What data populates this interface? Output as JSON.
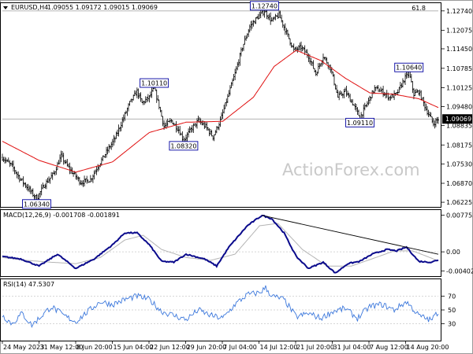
{
  "header": {
    "symbol": "EURUSD,H4",
    "ohlc": "1.09055 1.09172 1.09015 1.09069",
    "fib_label": "61.8"
  },
  "watermark": "ActionForex.com",
  "colors": {
    "price": "#000000",
    "ma": "#e01010",
    "macd": "#0a0a8c",
    "signal": "#b4b4b4",
    "rsi": "#3c78dc",
    "trendline": "#000000",
    "level_box": "#0000a0"
  },
  "chart_data": [
    {
      "type": "candlestick",
      "panel": "price",
      "title": "EURUSD,H4",
      "ylim": [
        1.0612,
        1.1295
      ],
      "y_ticks": [
        "1.12740",
        "1.12075",
        "1.11450",
        "1.10785",
        "1.10125",
        "1.09480",
        "1.08835",
        "1.08175",
        "1.07530",
        "1.06870",
        "1.06225"
      ],
      "x_labels": [
        "24 May 2023",
        "31 May 12:00",
        "8 Jun 20:00",
        "15 Jun 04:00",
        "22 Jun 12:00",
        "29 Jun 20:00",
        "7 Jul 04:00",
        "14 Jul 12:00",
        "21 Jul 20:00",
        "31 Jul 04:00",
        "7 Aug 12:00",
        "14 Aug 20:00"
      ],
      "path_anchors": [
        [
          0,
          1.0775
        ],
        [
          8,
          1.0745
        ],
        [
          14,
          1.0705
        ],
        [
          22,
          1.0665
        ],
        [
          28,
          1.0634
        ],
        [
          34,
          1.068
        ],
        [
          42,
          1.072
        ],
        [
          48,
          1.078
        ],
        [
          54,
          1.074
        ],
        [
          58,
          1.072
        ],
        [
          64,
          1.069
        ],
        [
          72,
          1.07
        ],
        [
          78,
          1.0745
        ],
        [
          86,
          1.08
        ],
        [
          92,
          1.084
        ],
        [
          98,
          1.09
        ],
        [
          104,
          1.096
        ],
        [
          110,
          1.1
        ],
        [
          114,
          1.096
        ],
        [
          120,
          1.098
        ],
        [
          124,
          1.1011
        ],
        [
          128,
          1.095
        ],
        [
          132,
          1.088
        ],
        [
          138,
          1.09
        ],
        [
          144,
          1.087
        ],
        [
          148,
          1.0832
        ],
        [
          154,
          1.087
        ],
        [
          160,
          1.09
        ],
        [
          166,
          1.088
        ],
        [
          172,
          1.0845
        ],
        [
          178,
          1.09
        ],
        [
          184,
          1.098
        ],
        [
          190,
          1.106
        ],
        [
          196,
          1.115
        ],
        [
          202,
          1.122
        ],
        [
          208,
          1.125
        ],
        [
          214,
          1.1274
        ],
        [
          220,
          1.124
        ],
        [
          226,
          1.126
        ],
        [
          232,
          1.12
        ],
        [
          238,
          1.114
        ],
        [
          244,
          1.115
        ],
        [
          250,
          1.112
        ],
        [
          256,
          1.106
        ],
        [
          262,
          1.112
        ],
        [
          268,
          1.108
        ],
        [
          274,
          1.098
        ],
        [
          280,
          1.1
        ],
        [
          286,
          1.096
        ],
        [
          292,
          1.0911
        ],
        [
          298,
          1.096
        ],
        [
          304,
          1.101
        ],
        [
          310,
          1.1
        ],
        [
          316,
          1.098
        ],
        [
          322,
          1.099
        ],
        [
          328,
          1.104
        ],
        [
          332,
          1.1064
        ],
        [
          336,
          1.099
        ],
        [
          340,
          1.1
        ],
        [
          346,
          1.094
        ],
        [
          352,
          1.089
        ],
        [
          356,
          1.0906
        ]
      ],
      "sma_anchors": [
        [
          0,
          1.083
        ],
        [
          30,
          1.0765
        ],
        [
          60,
          1.0725
        ],
        [
          90,
          1.076
        ],
        [
          120,
          1.086
        ],
        [
          150,
          1.0895
        ],
        [
          180,
          1.0898
        ],
        [
          205,
          1.098
        ],
        [
          222,
          1.1085
        ],
        [
          240,
          1.114
        ],
        [
          260,
          1.1105
        ],
        [
          280,
          1.1045
        ],
        [
          300,
          1.0995
        ],
        [
          320,
          1.099
        ],
        [
          340,
          1.0975
        ],
        [
          356,
          1.0945
        ]
      ],
      "current_price": "1.09069",
      "levels": [
        {
          "label": "1.06340",
          "value": 1.0634,
          "bar": 28,
          "pos": "below"
        },
        {
          "label": "1.10110",
          "value": 1.1011,
          "bar": 124,
          "pos": "above"
        },
        {
          "label": "1.08320",
          "value": 1.0832,
          "bar": 148,
          "pos": "below"
        },
        {
          "label": "1.12740",
          "value": 1.1274,
          "bar": 214,
          "pos": "above"
        },
        {
          "label": "1.09110",
          "value": 1.0911,
          "bar": 292,
          "pos": "below"
        },
        {
          "label": "1.10640",
          "value": 1.1064,
          "bar": 332,
          "pos": "above"
        }
      ],
      "fib_level": 1.1274,
      "support_line": 1.0906
    },
    {
      "type": "line",
      "panel": "macd",
      "title": "MACD(12,26,9) -0.001708 -0.001891",
      "ylim": [
        -0.0048,
        0.0085
      ],
      "y_ticks": [
        "0.007753",
        "0.00",
        "-0.004027"
      ],
      "macd_anchors": [
        [
          0,
          -0.001
        ],
        [
          15,
          -0.0015
        ],
        [
          30,
          -0.003
        ],
        [
          45,
          -0.0005
        ],
        [
          60,
          -0.0035
        ],
        [
          75,
          -0.0015
        ],
        [
          90,
          0.0015
        ],
        [
          100,
          0.004
        ],
        [
          110,
          0.004
        ],
        [
          120,
          0.0015
        ],
        [
          130,
          -0.002
        ],
        [
          140,
          -0.0022
        ],
        [
          150,
          -0.0005
        ],
        [
          165,
          -0.0015
        ],
        [
          175,
          -0.003
        ],
        [
          185,
          0.001
        ],
        [
          200,
          0.0055
        ],
        [
          212,
          0.0077
        ],
        [
          220,
          0.007
        ],
        [
          230,
          0.004
        ],
        [
          240,
          -0.001
        ],
        [
          250,
          -0.0035
        ],
        [
          262,
          -0.0022
        ],
        [
          272,
          -0.0045
        ],
        [
          282,
          -0.0025
        ],
        [
          292,
          -0.002
        ],
        [
          302,
          -0.0005
        ],
        [
          314,
          0.0005
        ],
        [
          322,
          0.0002
        ],
        [
          330,
          0.001
        ],
        [
          340,
          -0.002
        ],
        [
          350,
          -0.0022
        ],
        [
          356,
          -0.0017
        ]
      ],
      "signal_anchors": [
        [
          0,
          -0.0012
        ],
        [
          20,
          -0.0018
        ],
        [
          40,
          -0.0022
        ],
        [
          60,
          -0.0025
        ],
        [
          80,
          -0.0012
        ],
        [
          100,
          0.0025
        ],
        [
          115,
          0.0035
        ],
        [
          130,
          0.0005
        ],
        [
          150,
          -0.0012
        ],
        [
          170,
          -0.0018
        ],
        [
          190,
          -0.0005
        ],
        [
          210,
          0.0055
        ],
        [
          225,
          0.006
        ],
        [
          245,
          0.0005
        ],
        [
          265,
          -0.003
        ],
        [
          285,
          -0.003
        ],
        [
          305,
          -0.0012
        ],
        [
          320,
          0.0002
        ],
        [
          335,
          0.0002
        ],
        [
          356,
          -0.0019
        ]
      ],
      "trendline": [
        [
          212,
          0.0077
        ],
        [
          356,
          -0.0005
        ]
      ]
    },
    {
      "type": "line",
      "panel": "rsi",
      "title": "RSI(14) 47.5307",
      "ylim": [
        8,
        92
      ],
      "y_ticks": [
        "70",
        "50",
        "30"
      ],
      "guide_levels": [
        70,
        50,
        30
      ],
      "rsi_anchors": [
        [
          0,
          42
        ],
        [
          8,
          30
        ],
        [
          16,
          45
        ],
        [
          24,
          28
        ],
        [
          30,
          38
        ],
        [
          40,
          55
        ],
        [
          50,
          42
        ],
        [
          60,
          33
        ],
        [
          70,
          48
        ],
        [
          80,
          62
        ],
        [
          90,
          58
        ],
        [
          100,
          65
        ],
        [
          110,
          70
        ],
        [
          120,
          65
        ],
        [
          130,
          48
        ],
        [
          140,
          42
        ],
        [
          150,
          36
        ],
        [
          160,
          50
        ],
        [
          170,
          42
        ],
        [
          180,
          38
        ],
        [
          190,
          58
        ],
        [
          200,
          72
        ],
        [
          210,
          75
        ],
        [
          215,
          82
        ],
        [
          220,
          70
        ],
        [
          230,
          65
        ],
        [
          240,
          40
        ],
        [
          250,
          45
        ],
        [
          260,
          38
        ],
        [
          270,
          48
        ],
        [
          280,
          52
        ],
        [
          290,
          38
        ],
        [
          300,
          55
        ],
        [
          310,
          58
        ],
        [
          320,
          50
        ],
        [
          330,
          62
        ],
        [
          340,
          42
        ],
        [
          350,
          35
        ],
        [
          356,
          47.5
        ]
      ]
    }
  ]
}
